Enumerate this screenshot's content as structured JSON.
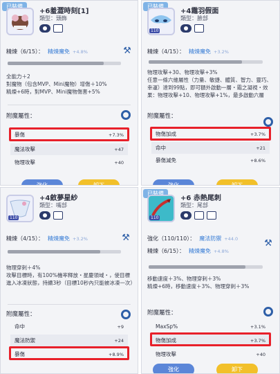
{
  "panels": [
    {
      "equip_tag": "已裝備",
      "name": "+6羞澀時刻[1]",
      "type": "類型：頭飾",
      "level": "",
      "refine": {
        "label": "精煉（6/15）：",
        "stat": "精煉魔免",
        "bonus": "+4.8%",
        "fill": 0.85
      },
      "desc": [
        "全能力＋2",
        "對魔物（包含MVP、Mini魔物）增傷＋10%",
        "精煉+6時，對MVP、Mini魔物傷害+5%"
      ],
      "enchant_title": "附魔屬性：",
      "attrs": [
        {
          "name": "暴傷",
          "value": "+7.3%"
        },
        {
          "name": "魔法攻擊",
          "value": "+47"
        },
        {
          "name": "物理攻擊",
          "value": "+40"
        }
      ],
      "buttons": [
        "強化",
        "卸下"
      ]
    },
    {
      "equip_tag": "已裝備",
      "name": "+4霜羽假面",
      "type": "類型：臉部",
      "level": "110",
      "refine": {
        "label": "精煉（4/15）：",
        "stat": "精煉魔免",
        "bonus": "+3.2%",
        "fill": 0.82
      },
      "desc": [
        "物理攻擊+30、物理攻擊+3%",
        "任意一條六維屬性（力量、敏捷、體質、智力、靈巧、幸運）達到99點，即可額外啟動一層・霜之凝視・效果：物理攻擊+10、物理攻擊+1%，最多啟動六層"
      ],
      "enchant_title": "附魔屬性：",
      "attrs": [
        {
          "name": "物傷加成",
          "value": "+3.7%"
        },
        {
          "name": "命中",
          "value": "+21"
        },
        {
          "name": "暴傷減免",
          "value": "+8.6%"
        }
      ],
      "buttons": [
        "強化",
        "卸下"
      ]
    },
    {
      "equip_tag": "",
      "name": "+4斂夢星紗",
      "type": "類型：嘴部",
      "level": "110",
      "refine": {
        "label": "精煉（4/15）：",
        "stat": "精煉魔免",
        "bonus": "+3.2%",
        "fill": 0.82
      },
      "desc": [
        "物理穿刺＋4%",
        "攻擊目標時，有100%機率釋放・星慶領域・，使目標進入冰凍狀態，持續3秒（目標10秒內只能被冰凍一次）"
      ],
      "enchant_title": "附魔屬性：",
      "attrs": [
        {
          "name": "命中",
          "value": "+9"
        },
        {
          "name": "魔法防禦",
          "value": "+24"
        },
        {
          "name": "暴傷",
          "value": "+8.9%"
        }
      ],
      "buttons": []
    },
    {
      "equip_tag": "已裝備",
      "name": "+6 赤熱尾刺",
      "type": "類型：尾部",
      "level": "110",
      "strengthen": {
        "label": "強化（110/110）：",
        "stat": "魔法防禦",
        "bonus": "+44.0"
      },
      "refine": {
        "label": "精煉（6/15）：",
        "stat": "精煉魔免",
        "bonus": "+4.8%",
        "fill": 0.85
      },
      "desc": [
        "移動速度＋3%、物理穿刺＋3%",
        "精煉+6時，移動速度＋3%、物理穿刺＋3%"
      ],
      "enchant_title": "附魔屬性：",
      "attrs": [
        {
          "name": "MaxSp%",
          "value": "+3.1%"
        },
        {
          "name": "物傷加成",
          "value": "+3.7%"
        },
        {
          "name": "物理攻擊",
          "value": "+40"
        }
      ],
      "buttons": [
        "強化",
        "卸下"
      ]
    }
  ],
  "colors": {
    "highlight": "#e8202a",
    "accent": "#3a7ed6",
    "button_blue": "#5b86d8",
    "button_yellow": "#f2c02a"
  },
  "icons": [
    "eye-icon",
    "book-icon",
    "hammer-icon",
    "gear-icon"
  ]
}
